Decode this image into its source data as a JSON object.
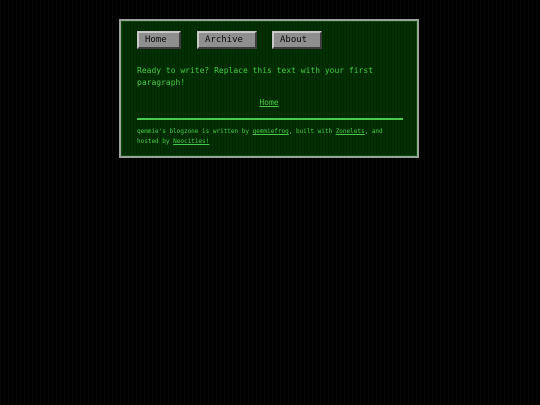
{
  "nav": {
    "items": [
      {
        "label": "Home"
      },
      {
        "label": "Archive"
      },
      {
        "label": "About"
      }
    ]
  },
  "content": {
    "intro": "Ready to write? Replace this text with your first paragraph!",
    "home_link": "Home"
  },
  "footer": {
    "prefix": "qemmie's blogzone is written by ",
    "author_link": "qemmiefrog",
    "mid1": ", built with ",
    "builder_link": "Zonelets",
    "mid2": ", and hosted by ",
    "host_link": "Neocities!"
  },
  "colors": {
    "background": "#000000",
    "panel": "#033003",
    "text": "#49c949",
    "button": "#8f8f8f"
  }
}
